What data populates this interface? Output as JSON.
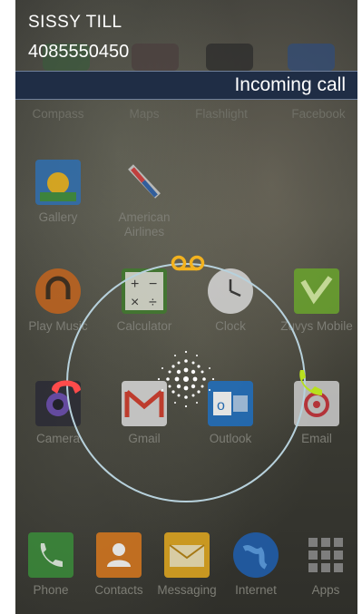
{
  "call": {
    "caller_name": "SISSY TILL",
    "caller_number": "4085550450",
    "status": "Incoming call"
  },
  "apps_row1": [
    {
      "label": "Compass",
      "icon": "compass-icon"
    },
    {
      "label": "Maps",
      "icon": "maps-icon"
    },
    {
      "label": "Flashlight",
      "icon": "flashlight-icon"
    },
    {
      "label": "Facebook",
      "icon": "facebook-icon"
    }
  ],
  "apps_row2": [
    {
      "label": "Gallery",
      "icon": "gallery-icon"
    },
    {
      "label": "American Airlines",
      "icon": "american-airlines-icon"
    }
  ],
  "apps_row3": [
    {
      "label": "Play Music",
      "icon": "play-music-icon"
    },
    {
      "label": "Calculator",
      "icon": "calculator-icon"
    },
    {
      "label": "Clock",
      "icon": "clock-icon"
    },
    {
      "label": "Zuvys Mobile",
      "icon": "zuvys-mobile-icon"
    }
  ],
  "apps_row4": [
    {
      "label": "Camera",
      "icon": "camera-icon"
    },
    {
      "label": "Gmail",
      "icon": "gmail-icon"
    },
    {
      "label": "Outlook",
      "icon": "outlook-icon"
    },
    {
      "label": "Email",
      "icon": "email-icon"
    }
  ],
  "dock": [
    {
      "label": "Phone",
      "icon": "phone-icon"
    },
    {
      "label": "Contacts",
      "icon": "contacts-icon"
    },
    {
      "label": "Messaging",
      "icon": "messaging-icon"
    },
    {
      "label": "Internet",
      "icon": "internet-icon"
    },
    {
      "label": "Apps",
      "icon": "apps-grid-icon"
    }
  ],
  "colors": {
    "status_bar": "#1f2d45",
    "ring": "#b7d1dc",
    "decline": "#ff4b4b",
    "answer": "#b8e01e",
    "voicemail": "#f2b21f"
  }
}
